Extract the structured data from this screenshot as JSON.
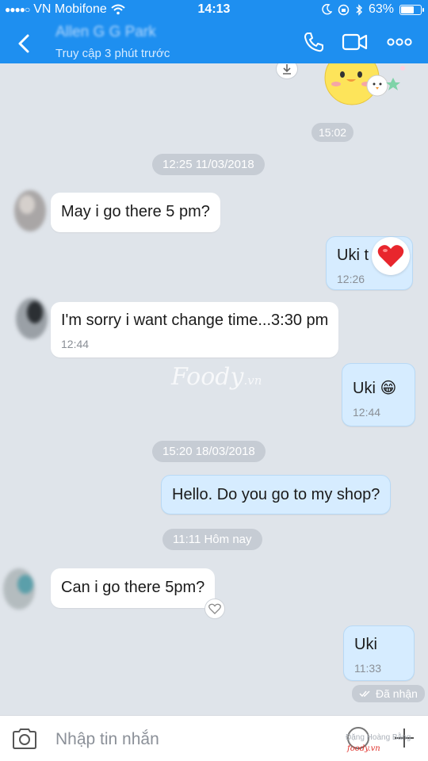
{
  "status_bar": {
    "carrier": "VN Mobifone",
    "time": "14:13",
    "battery": "63%",
    "battery_level": 0.63
  },
  "header": {
    "contact_name": "Allen G G Park",
    "subtitle": "Truy cập 3 phút trước",
    "icons": [
      "back-arrow-icon",
      "phone-icon",
      "video-camera-icon",
      "more-icon"
    ]
  },
  "chat": {
    "sticker_time": "15:02",
    "pill_1": "12:25 11/03/2018",
    "msg_1": {
      "text": "May i go there 5 pm?"
    },
    "msg_2": {
      "text": "Uki t",
      "time": "12:26",
      "reaction": "heart"
    },
    "msg_3": {
      "text": "I'm sorry i want change time...3:30 pm",
      "time": "12:44"
    },
    "msg_4": {
      "text": "Uki",
      "emoji": "😁",
      "time": "12:44"
    },
    "pill_2": "15:20 18/03/2018",
    "msg_5": {
      "text": "Hello. Do you go to  my shop?"
    },
    "pill_3": "11:11 Hôm nay",
    "msg_6": {
      "text": "Can i go there 5pm?"
    },
    "msg_7": {
      "text": "Uki",
      "time": "11:33"
    },
    "delivery_status": "Đã nhận",
    "watermark": "Foody",
    "watermark_suffix": ".vn"
  },
  "composer": {
    "placeholder": "Nhập tin nhắn",
    "credit": "Đặng Hoàng Bằng",
    "credit_brand": "foody.vn"
  },
  "colors": {
    "header": "#1e8ff0",
    "chat_bg": "#dfe4ea",
    "outgoing_bubble": "#d6ecff",
    "incoming_bubble": "#ffffff"
  }
}
